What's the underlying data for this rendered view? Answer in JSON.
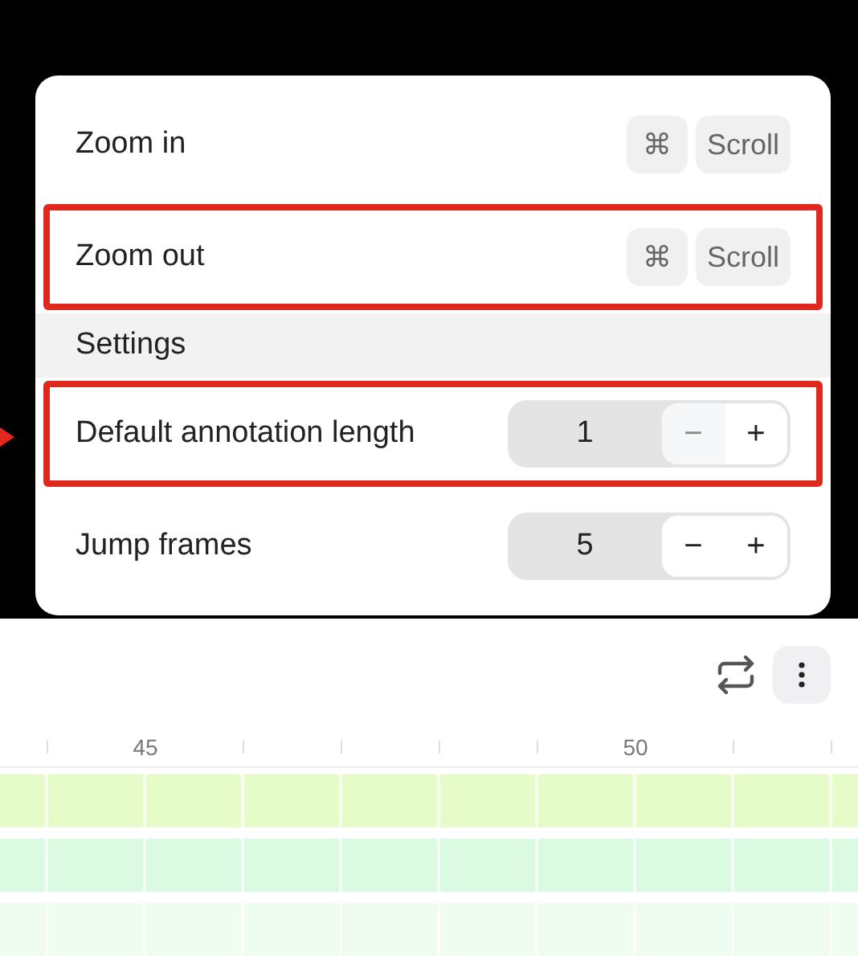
{
  "menu": {
    "items": [
      {
        "kind": "action",
        "label": "Zoom in",
        "shortcut": [
          "⌘",
          "Scroll"
        ],
        "highlighted": false
      },
      {
        "kind": "action",
        "label": "Zoom out",
        "shortcut": [
          "⌘",
          "Scroll"
        ],
        "highlighted": true
      },
      {
        "kind": "header",
        "label": "Settings"
      },
      {
        "kind": "stepper",
        "label": "Default annotation length",
        "value": "1",
        "decrement": "−",
        "increment": "+",
        "decrement_disabled": true,
        "highlighted": true
      },
      {
        "kind": "stepper",
        "label": "Jump frames",
        "value": "5",
        "decrement": "−",
        "increment": "+",
        "decrement_disabled": false,
        "highlighted": false
      }
    ]
  },
  "ruler": {
    "ticks": [
      {
        "kind": "tick"
      },
      {
        "kind": "label",
        "label": "45"
      },
      {
        "kind": "tick"
      },
      {
        "kind": "tick"
      },
      {
        "kind": "tick"
      },
      {
        "kind": "tick"
      },
      {
        "kind": "label",
        "label": "50"
      },
      {
        "kind": "tick"
      },
      {
        "kind": "tick"
      }
    ]
  },
  "tracks": [
    {
      "color": "#e6fcc8"
    },
    {
      "color": "#dafbe2"
    },
    {
      "color": "#eefdf0"
    }
  ]
}
